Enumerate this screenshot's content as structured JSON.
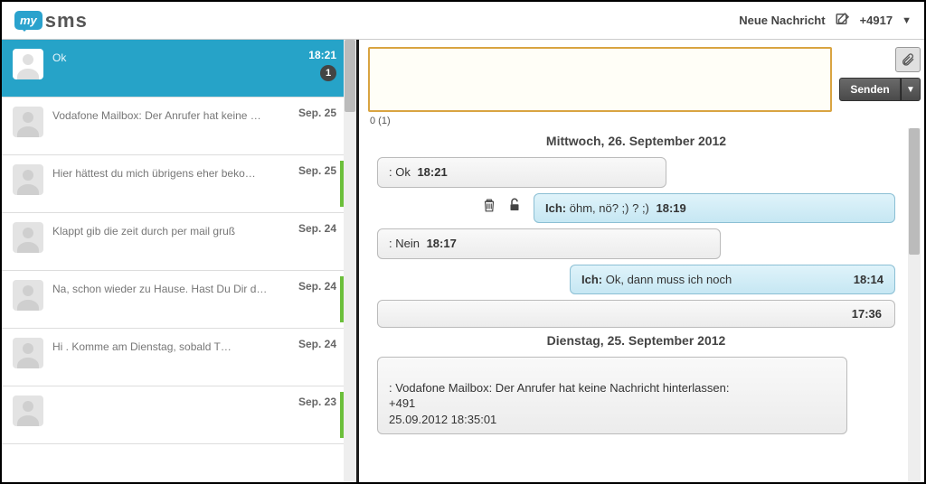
{
  "topbar": {
    "logo_my": "my",
    "logo_sms": "sms",
    "new_message": "Neue Nachricht",
    "phone": "+4917",
    "caret": "▼"
  },
  "sidebar": {
    "items": [
      {
        "name": " ",
        "preview": "Ok",
        "time": "18:21",
        "badge": "1",
        "active": true,
        "stripe": false
      },
      {
        "name": " ",
        "preview": "Vodafone Mailbox: Der Anrufer hat keine …",
        "time": "Sep. 25",
        "active": false,
        "stripe": false
      },
      {
        "name": " ",
        "preview": "Hier hättest du mich übrigens eher beko…",
        "time": "Sep. 25",
        "active": false,
        "stripe": true
      },
      {
        "name": " ",
        "preview": "Klappt gib die zeit durch per mail gruß",
        "time": "Sep. 24",
        "active": false,
        "stripe": false
      },
      {
        "name": " ",
        "preview": "Na, schon wieder zu Hause. Hast Du Dir d…",
        "time": "Sep. 24",
        "active": false,
        "stripe": true
      },
      {
        "name": " ",
        "preview": "Hi        . Komme am Dienstag, sobald T…",
        "time": "Sep. 24",
        "active": false,
        "stripe": false
      },
      {
        "name": " ",
        "preview": " ",
        "time": "Sep. 23",
        "active": false,
        "stripe": true
      }
    ]
  },
  "compose": {
    "counter": "0 (1)",
    "send": "Senden",
    "drop": "▼"
  },
  "chat": {
    "day1": "Mittwoch, 26. September 2012",
    "day2": "Dienstag, 25. September 2012",
    "m1_who": "",
    "m1_text": ": Ok ",
    "m1_time": "18:21",
    "m2_who": "Ich:",
    "m2_text": " öhm, nö? ;)                                                ? ;) ",
    "m2_time": "18:19",
    "m3_who": "",
    "m3_text": ": Nein                                               ",
    "m3_time": "18:17",
    "m4_who": "Ich:",
    "m4_text": " Ok, dann muss ich noch",
    "m4_time": "18:14",
    "m5_time": "17:36",
    "m6_text": "      : Vodafone Mailbox: Der Anrufer hat keine Nachricht hinterlassen:\n+491\n25.09.2012 18:35:01"
  }
}
